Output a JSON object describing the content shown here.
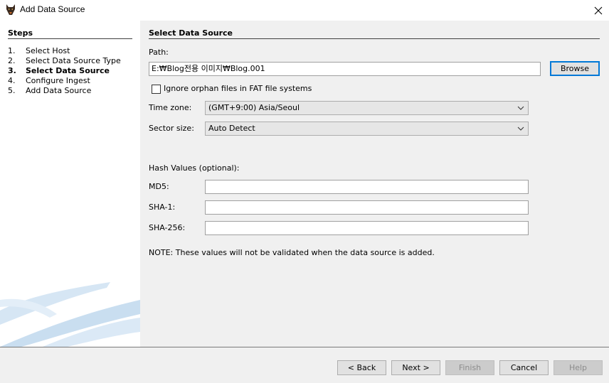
{
  "window": {
    "title": "Add Data Source",
    "close_glyph": "✕",
    "app_icon": "autopsy-dog-icon"
  },
  "steps": {
    "header": "Steps",
    "items": [
      {
        "num": "1.",
        "label": "Select Host",
        "active": false
      },
      {
        "num": "2.",
        "label": "Select Data Source Type",
        "active": false
      },
      {
        "num": "3.",
        "label": "Select Data Source",
        "active": true
      },
      {
        "num": "4.",
        "label": "Configure Ingest",
        "active": false
      },
      {
        "num": "5.",
        "label": "Add Data Source",
        "active": false
      }
    ]
  },
  "main": {
    "title": "Select Data Source",
    "path_label": "Path:",
    "path_value": "E:₩Blog전용 이미지₩Blog.001",
    "browse_label": "Browse",
    "orphan_label": "Ignore orphan files in FAT file systems",
    "orphan_checked": false,
    "timezone_label": "Time zone:",
    "timezone_value": "(GMT+9:00) Asia/Seoul",
    "sector_label": "Sector size:",
    "sector_value": "Auto Detect",
    "hash_header": "Hash Values (optional):",
    "md5_label": "MD5:",
    "md5_value": "",
    "sha1_label": "SHA-1:",
    "sha1_value": "",
    "sha256_label": "SHA-256:",
    "sha256_value": "",
    "note": "NOTE: These values will not be validated when the data source is added."
  },
  "footer": {
    "back_label": "< Back",
    "next_label": "Next >",
    "finish_label": "Finish",
    "cancel_label": "Cancel",
    "help_label": "Help"
  },
  "colors": {
    "accent_focus": "#0078d7",
    "panel_bg": "#f0f0f0",
    "steps_bg": "#ffffff",
    "swoosh": "#c9def0"
  }
}
